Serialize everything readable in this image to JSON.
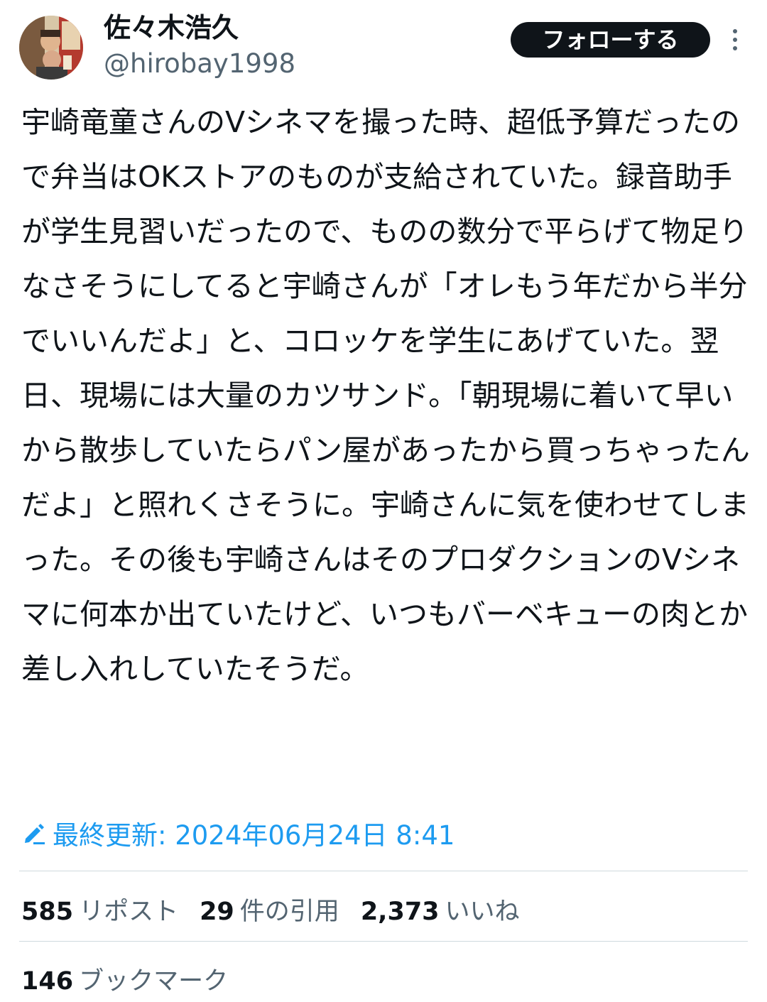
{
  "author": {
    "display_name": "佐々木浩久",
    "handle": "@hirobay1998"
  },
  "header": {
    "follow_label": "フォローする",
    "more_icon": "more-vertical-icon"
  },
  "tweet": {
    "text": "宇崎竜童さんのVシネマを撮った時、超低予算だったので弁当はOKストアのものが支給されていた。録音助手が学生見習いだったので、ものの数分で平らげて物足りなさそうにしてると宇崎さんが「オレもう年だから半分でいいんだよ」と、コロッケを学生にあげていた。翌日、現場には大量のカツサンド。「朝現場に着いて早いから散歩していたらパン屋があったから買っちゃったんだよ」と照れくさそうに。宇崎さんに気を使わせてしまった。その後も宇崎さんはそのプロダクションのVシネマに何本か出ていたけど、いつもバーベキューの肉とか差し入れしていたそうだ。",
    "edited_icon": "pencil-icon",
    "edited_label": "最終更新: 2024年06月24日 8:41"
  },
  "stats": {
    "reposts_count": "585",
    "reposts_label": "リポスト",
    "quotes_count": "29",
    "quotes_label": "件の引用",
    "likes_count": "2,373",
    "likes_label": "いいね",
    "bookmarks_count": "146",
    "bookmarks_label": "ブックマーク"
  },
  "colors": {
    "text": "#0f1419",
    "secondary": "#536471",
    "accent": "#1d9bf0",
    "divider": "#cfd9de"
  }
}
